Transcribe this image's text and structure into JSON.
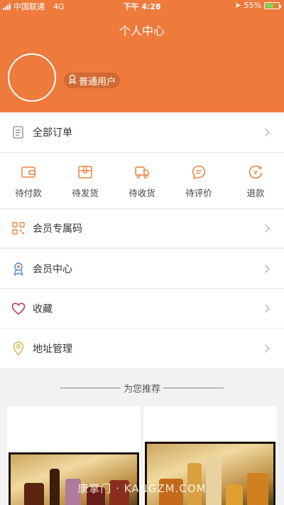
{
  "status": {
    "carrier": "中国联通",
    "network": "4G",
    "time": "下午 4:28",
    "battery": "55%"
  },
  "header": {
    "title": "个人中心",
    "user_level": "普通用户"
  },
  "all_orders": {
    "label": "全部订单"
  },
  "order_status": [
    {
      "label": "待付款",
      "icon": "wallet-icon"
    },
    {
      "label": "待发货",
      "icon": "package-icon"
    },
    {
      "label": "待收货",
      "icon": "truck-icon"
    },
    {
      "label": "待评价",
      "icon": "comment-icon"
    },
    {
      "label": "退款",
      "icon": "refund-icon"
    }
  ],
  "menu": [
    {
      "label": "会员专属码",
      "icon": "qrcode-icon"
    },
    {
      "label": "会员中心",
      "icon": "medal-icon"
    },
    {
      "label": "收藏",
      "icon": "heart-icon"
    },
    {
      "label": "地址管理",
      "icon": "location-pin-icon"
    }
  ],
  "recommend": {
    "title": "为您推荐"
  },
  "watermark": "康掌门 · KANGZM.COM",
  "colors": {
    "accent": "#ee7a3c",
    "icon_orange": "#e8833f"
  }
}
